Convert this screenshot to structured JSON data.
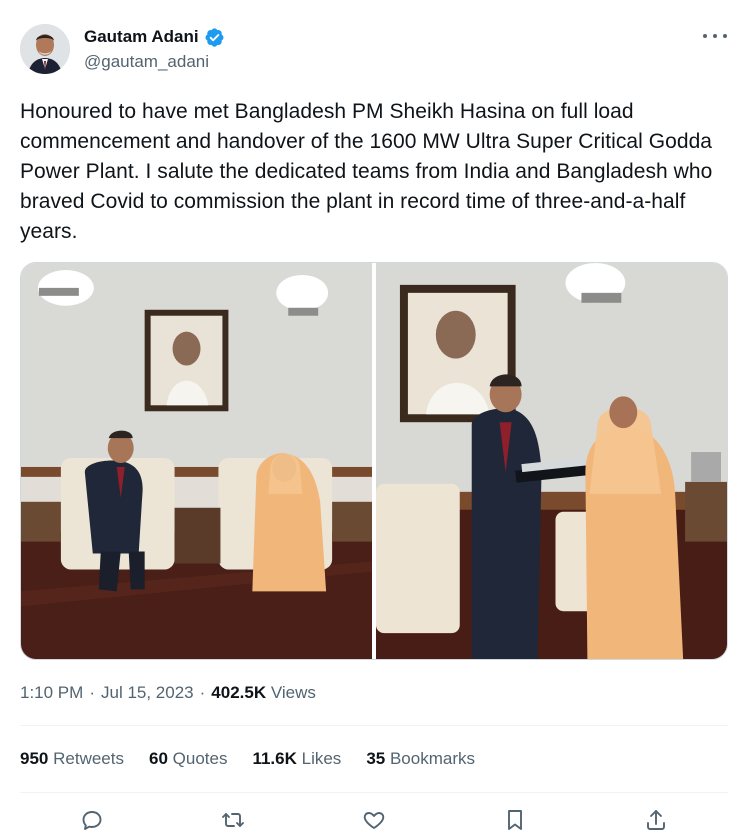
{
  "author": {
    "display_name": "Gautam Adani",
    "handle": "@gautam_adani",
    "verified": true
  },
  "tweet": {
    "text": "Honoured to have met Bangladesh PM Sheikh Hasina on full load commencement and handover of the 1600 MW Ultra Super Critical Godda Power Plant. I salute the dedicated teams from India and Bangladesh who braved Covid to commission the plant in record time of three-and-a-half years."
  },
  "meta": {
    "time": "1:10 PM",
    "date": "Jul 15, 2023",
    "separator": "·",
    "views_count": "402.5K",
    "views_label": "Views"
  },
  "stats": [
    {
      "count": "950",
      "label": "Retweets"
    },
    {
      "count": "60",
      "label": "Quotes"
    },
    {
      "count": "11.6K",
      "label": "Likes"
    },
    {
      "count": "35",
      "label": "Bookmarks"
    }
  ],
  "colors": {
    "verified_blue": "#1d9bf0",
    "muted_text": "#536471",
    "primary_text": "#0f1419"
  },
  "icons": [
    "more-icon",
    "verified-badge-icon",
    "reply-icon",
    "retweet-icon",
    "like-icon",
    "bookmark-icon",
    "share-icon"
  ]
}
